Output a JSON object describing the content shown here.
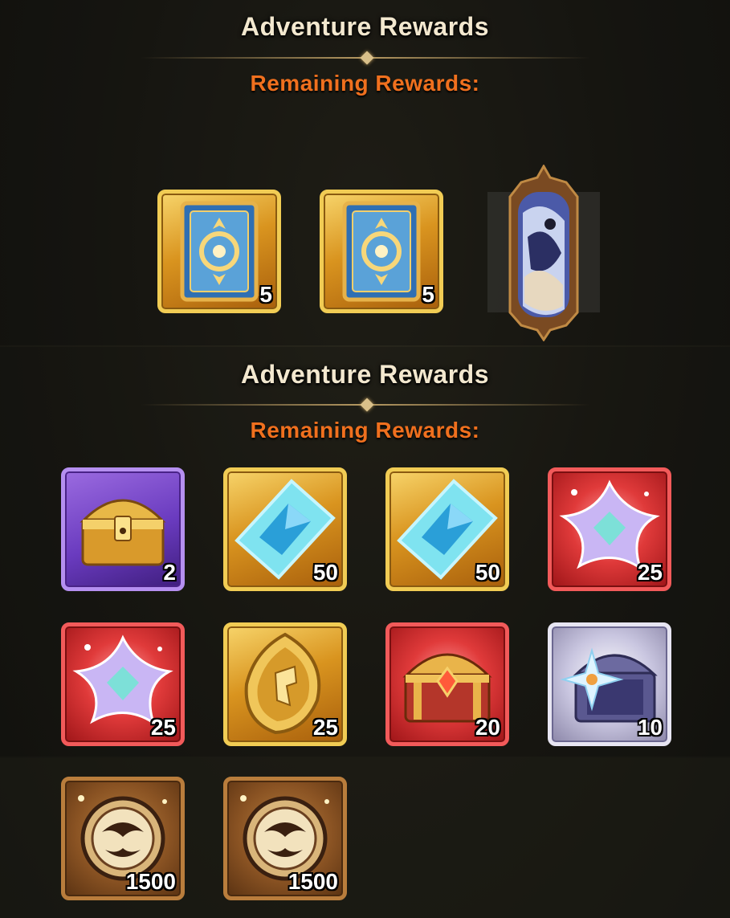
{
  "top_panel": {
    "title": "Adventure Rewards",
    "subtitle": "Remaining Rewards:",
    "rewards": [
      {
        "icon": "card-icon",
        "qty": "5"
      },
      {
        "icon": "card-icon",
        "qty": "5"
      },
      {
        "icon": "hero-portrait-icon"
      }
    ]
  },
  "bottom_panel": {
    "title": "Adventure Rewards",
    "subtitle": "Remaining Rewards:",
    "rewards": [
      {
        "icon": "chest-icon",
        "qty": "2",
        "frame": "purple"
      },
      {
        "icon": "diamond-crystal-icon",
        "qty": "50",
        "frame": "gold"
      },
      {
        "icon": "diamond-crystal-icon",
        "qty": "50",
        "frame": "gold"
      },
      {
        "icon": "star-shard-icon",
        "qty": "25",
        "frame": "red"
      },
      {
        "icon": "star-shard-icon",
        "qty": "25",
        "frame": "red"
      },
      {
        "icon": "gold-emblem-icon",
        "qty": "25",
        "frame": "gold"
      },
      {
        "icon": "red-chest-icon",
        "qty": "20",
        "frame": "red"
      },
      {
        "icon": "silver-chest-icon",
        "qty": "10",
        "frame": "silver"
      },
      {
        "icon": "bronze-medal-icon",
        "qty": "1500",
        "frame": "bronze"
      },
      {
        "icon": "bronze-medal-icon",
        "qty": "1500",
        "frame": "bronze"
      }
    ]
  },
  "colors": {
    "title": "#f3e8cf",
    "subtitle": "#f0701e",
    "background": "#1b1a14"
  }
}
